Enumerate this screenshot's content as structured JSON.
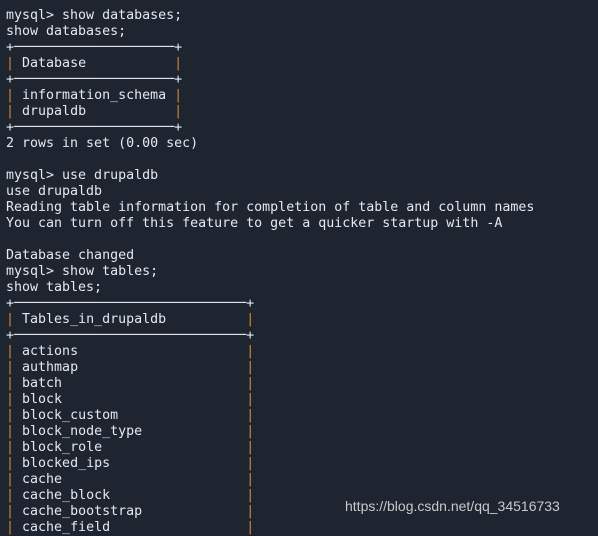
{
  "terminal": {
    "lines": [
      {
        "type": "text",
        "text": "mysql> show databases;"
      },
      {
        "type": "text",
        "text": "show databases;"
      },
      {
        "type": "table",
        "width": 20,
        "header": "Database",
        "rows": [
          "information_schema",
          "drupaldb"
        ]
      },
      {
        "type": "text",
        "text": "2 rows in set (0.00 sec)"
      },
      {
        "type": "text",
        "text": ""
      },
      {
        "type": "text",
        "text": "mysql> use drupaldb"
      },
      {
        "type": "text",
        "text": "use drupaldb"
      },
      {
        "type": "text",
        "text": "Reading table information for completion of table and column names"
      },
      {
        "type": "text",
        "text": "You can turn off this feature to get a quicker startup with -A"
      },
      {
        "type": "text",
        "text": ""
      },
      {
        "type": "text",
        "text": "Database changed"
      },
      {
        "type": "text",
        "text": "mysql> show tables;"
      },
      {
        "type": "text",
        "text": "show tables;"
      },
      {
        "type": "table",
        "width": 29,
        "header": "Tables_in_drupaldb",
        "open": true,
        "rows": [
          "actions",
          "authmap",
          "batch",
          "block",
          "block_custom",
          "block_node_type",
          "block_role",
          "blocked_ips",
          "cache",
          "cache_block",
          "cache_bootstrap",
          "cache_field"
        ]
      }
    ]
  },
  "watermark": "https://blog.csdn.net/qq_34516733",
  "colors": {
    "background": "#1f2431",
    "text": "#e6e8ee",
    "table_border": "#d6873a"
  }
}
